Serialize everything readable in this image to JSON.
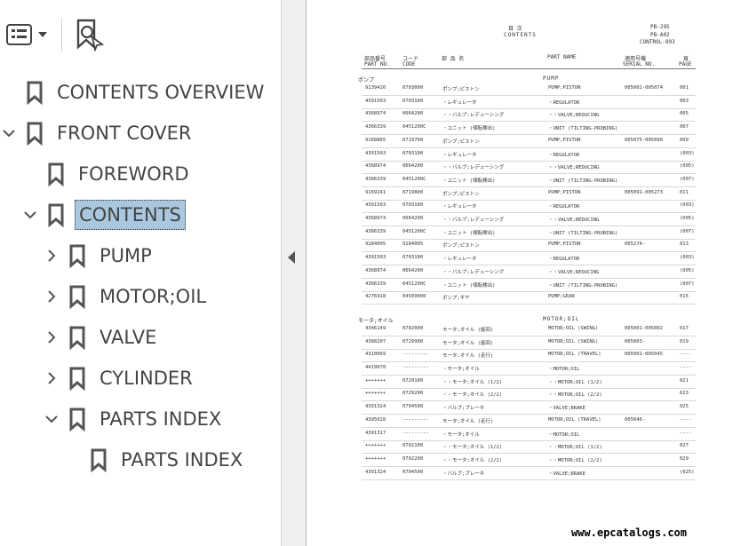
{
  "sidebar": {
    "items": [
      {
        "label": "CONTENTS OVERVIEW",
        "level": 0,
        "expander": "none",
        "selected": false
      },
      {
        "label": "FRONT COVER",
        "level": 0,
        "expander": "open",
        "selected": false
      },
      {
        "label": "FOREWORD",
        "level": 1,
        "expander": "none",
        "selected": false
      },
      {
        "label": "CONTENTS",
        "level": 1,
        "expander": "open",
        "selected": true
      },
      {
        "label": "PUMP",
        "level": 2,
        "expander": "closed",
        "selected": false
      },
      {
        "label": "MOTOR;OIL",
        "level": 2,
        "expander": "closed",
        "selected": false
      },
      {
        "label": "VALVE",
        "level": 2,
        "expander": "closed",
        "selected": false
      },
      {
        "label": "CYLINDER",
        "level": 2,
        "expander": "closed",
        "selected": false
      },
      {
        "label": "PARTS INDEX",
        "level": 2,
        "expander": "open",
        "selected": false
      },
      {
        "label": "PARTS INDEX",
        "level": 3,
        "expander": "none",
        "selected": false
      }
    ]
  },
  "doc": {
    "title_jp": "目 次",
    "title_en": "CONTENTS",
    "codes": [
      "PB-295",
      "PB-A02",
      "CONTROL-893"
    ],
    "headers": {
      "partno_jp": "部品番号",
      "partno_en": "PART NO.",
      "code_jp": "コード",
      "code_en": "CODE",
      "name_jp": "部 品 名",
      "partname_en": "PART NAME",
      "serial_jp": "適用号機",
      "serial_en": "SERIAL NO.",
      "page_jp": "頁",
      "page_en": "PAGE"
    },
    "sections": [
      {
        "jp": "ポンプ",
        "en": "PUMP",
        "rows": [
          [
            "9139426",
            "0703000",
            "ポンプ;ピストン",
            "PUMP;PISTON",
            "005001-005074",
            "001"
          ],
          [
            "4391503",
            "0703100",
            "・レギュレータ",
            "・REGULATOR",
            "",
            "003"
          ],
          [
            "4368974",
            "0664200",
            "・・バルブ;レデューシング",
            "・・VALVE;REDUCING",
            "",
            "005"
          ],
          [
            "4366339",
            "0451200C",
            "・ユニット (傾転検出)",
            "・UNIT (TILTING-PROBING)",
            "",
            "007"
          ],
          [
            "9168865",
            "0719700",
            "ポンプ;ピストン",
            "PUMP;PISTON",
            "005075-005090",
            "009"
          ],
          [
            "4391503",
            "0703100",
            "・レギュレータ",
            "・REGULATOR",
            "",
            "(003)"
          ],
          [
            "4368974",
            "0664200",
            "・・バルブ;レデューシング",
            "・・VALVE;REDUCING",
            "",
            "(005)"
          ],
          [
            "4366339",
            "0451200C",
            "・ユニット (傾転検出)",
            "・UNIT (TILTING-PROBING)",
            "",
            "(007)"
          ],
          [
            "9169241",
            "0719800",
            "ポンプ;ピストン",
            "PUMP;PISTON",
            "005091-005273",
            "011"
          ],
          [
            "4391503",
            "0703100",
            "・レギュレータ",
            "・REGULATOR",
            "",
            "(003)"
          ],
          [
            "4368974",
            "0664200",
            "・・バルブ;レデューシング",
            "・・VALVE;REDUCING",
            "",
            "(005)"
          ],
          [
            "4366339",
            "0451200C",
            "・ユニット (傾転検出)",
            "・UNIT (TILTING-PROBING)",
            "",
            "(007)"
          ],
          [
            "9184005",
            "9184005",
            "ポンプ;ピストン",
            "PUMP;PISTON",
            "005274-",
            "013"
          ],
          [
            "4391503",
            "0703100",
            "・レギュレータ",
            "・REGULATOR",
            "",
            "(003)"
          ],
          [
            "4368974",
            "0664200",
            "・・バルブ;レデューシング",
            "・・VALVE;REDUCING",
            "",
            "(005)"
          ],
          [
            "4366339",
            "0451200C",
            "・ユニット (傾転検出)",
            "・UNIT (TILTING-PROBING)",
            "",
            "(007)"
          ],
          [
            "4276918",
            "04509000",
            "ポンプ;ギヤ",
            "PUMP;GEAR",
            "",
            "015"
          ]
        ]
      },
      {
        "jp": "モータ;オイル",
        "en": "MOTOR;OIL",
        "rows": [
          [
            "4346149",
            "0702000",
            "モータ;オイル (旋回)",
            "MOTOR;OIL (SWING)",
            "005001-005002",
            "017"
          ],
          [
            "4388207",
            "0729900",
            "モータ;オイル (旋回)",
            "MOTOR;OIL (SWING)",
            "005003-",
            "019"
          ],
          [
            "4310069",
            "---------",
            "モータ;オイル (走行)",
            "MOTOR;OIL (TRAVEL)",
            "005001-005045",
            "----"
          ],
          [
            "4419070",
            "---------",
            "・モータ;オイル",
            "・MOTOR;OIL",
            "",
            "----"
          ],
          [
            "+++++++",
            "0729100",
            "・・モータ;オイル (1/2)",
            "・・MOTOR;OIL (1/2)",
            "",
            "021"
          ],
          [
            "+++++++",
            "0729200",
            "・・モータ;オイル (2/2)",
            "・・MOTOR;OIL (2/2)",
            "",
            "023"
          ],
          [
            "4391324",
            "0704500",
            "・バルブ;ブレーキ",
            "・VALVE;BRAKE",
            "",
            "025"
          ],
          [
            "4395028",
            "---------",
            "モータ;オイル (走行)",
            "MOTOR;OIL (TRAVEL)",
            "005046-",
            "----"
          ],
          [
            "4391317",
            "---------",
            "・モータ;オイル",
            "・MOTOR;OIL",
            "",
            "----"
          ],
          [
            "+++++++",
            "0702100",
            "・・モータ;オイル (1/2)",
            "・・MOTOR;OIL (1/2)",
            "",
            "027"
          ],
          [
            "+++++++",
            "0702200",
            "・・モータ;オイル (2/2)",
            "・・MOTOR;OIL (2/2)",
            "",
            "029"
          ],
          [
            "4391324",
            "0704500",
            "・バルブ;ブレーキ",
            "・VALVE;BRAKE",
            "",
            "(025)"
          ]
        ]
      }
    ],
    "footer": "www.epcatalogs.com"
  }
}
